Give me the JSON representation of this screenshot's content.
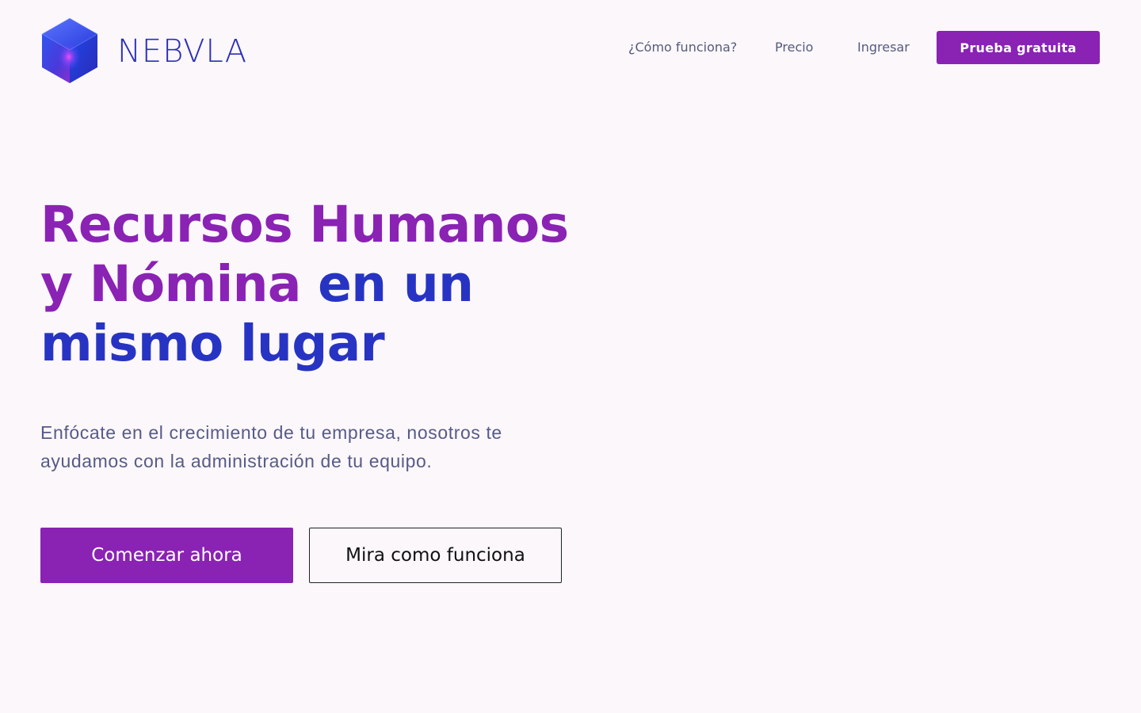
{
  "brand": {
    "name": "NEBVLA",
    "logo_icon": "hexagon-cube-logo-icon",
    "colors": {
      "primary": "#8a22b4",
      "secondary": "#2734c3",
      "background": "#fbf7fb"
    }
  },
  "nav": {
    "how_it_works": "¿Cómo funciona?",
    "price": "Precio",
    "login": "Ingresar",
    "cta": "Prueba gratuita"
  },
  "hero": {
    "title_part1": "Recursos Humanos y Nómina",
    "title_part2": "en un mismo lugar",
    "subtitle": "Enfócate en el crecimiento de tu empresa, nosotros te ayudamos con la administración de tu equipo.",
    "primary_button": "Comenzar ahora",
    "secondary_button": "Mira como funciona"
  }
}
